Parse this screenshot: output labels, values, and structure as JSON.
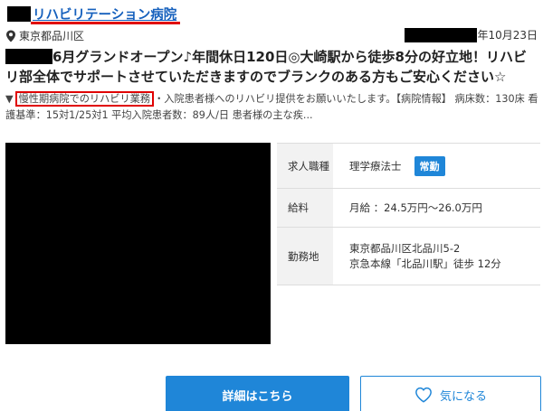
{
  "job": {
    "title": "リハビリテーション病院",
    "location": "東京都品川区",
    "date_suffix": "年10月23日",
    "headline": "6月グランドオープン♪年間休日120日◎大崎駅から徒歩8分の好立地！リハビリ部全体でサポートさせていただきますのでブランクのある方もご安心ください☆",
    "desc_marker": "▼",
    "desc_highlight": "慢性期病院でのリハビリ業務",
    "desc_text": "・入院患者様へのリハビリ提供をお願いいたします。【病院情報】 病床数：130床 看護基準：15対1/25対1 平均入院患者数：89人/日 患者様の主な疾..."
  },
  "info": {
    "type_label": "求人職種",
    "type_value": "理学療法士",
    "type_badge": "常勤",
    "salary_label": "給料",
    "salary_value": "月給 ：24.5万円〜26.0万円",
    "place_label": "勤務地",
    "place_line1": "東京都品川区北品川5-2",
    "place_line2": "京急本線「北品川駅」徒歩 12分"
  },
  "buttons": {
    "detail": "詳細はこちら",
    "favorite": "気になる"
  },
  "colors": {
    "link": "#1560bd",
    "accent": "#1f86d8",
    "highlight": "#e00000"
  },
  "icons": {
    "location": "map-pin-icon",
    "favorite": "heart-icon"
  }
}
